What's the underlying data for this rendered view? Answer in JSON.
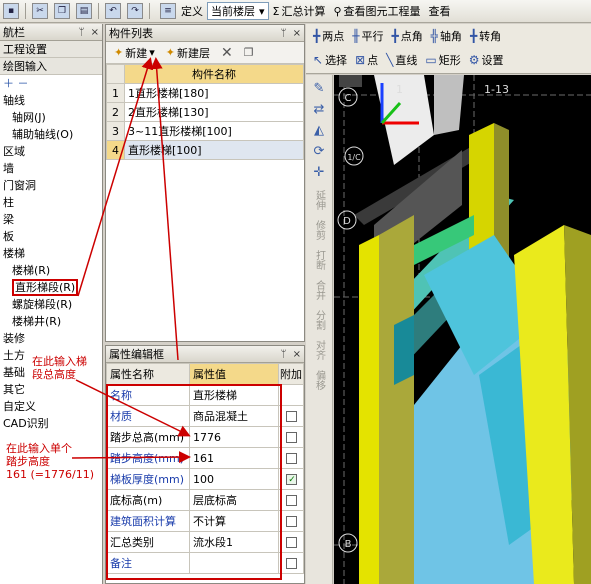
{
  "toolbar": {
    "define": "定义",
    "floor_select": "当前楼层",
    "sum_calc": "汇总计算",
    "view_quantity": "查看图元工程量",
    "view_more": "查看"
  },
  "nav": {
    "title": "航栏",
    "section_project": "工程设置",
    "section_draw": "绘图输入",
    "items": [
      "轴线",
      "轴网(J)",
      "辅助轴线(O)",
      "区域",
      "墙",
      "门窗洞",
      "柱",
      "梁",
      "板",
      "楼梯",
      "楼梯(R)",
      "直形梯段(R)",
      "螺旋梯段(R)",
      "楼梯井(R)",
      "装修",
      "土方",
      "基础",
      "其它",
      "自定义",
      "CAD识别"
    ]
  },
  "component_list": {
    "title": "构件列表",
    "new_button": "新建",
    "new_layer_button": "新建层",
    "column_header": "构件名称",
    "rows": [
      {
        "num": "1",
        "name": "1直形楼梯[180]"
      },
      {
        "num": "2",
        "name": "2直形楼梯[130]"
      },
      {
        "num": "3",
        "name": "3~11直形楼梯[100]"
      },
      {
        "num": "4",
        "name": "直形楼梯[100]"
      }
    ]
  },
  "property_editor": {
    "title": "属性编辑框",
    "header_name": "属性名称",
    "header_value": "属性值",
    "header_add": "附加",
    "rows": [
      {
        "name": "名称",
        "value": "直形楼梯",
        "checkbox": "none",
        "blue": true
      },
      {
        "name": "材质",
        "value": "商品混凝土",
        "checkbox": "off",
        "blue": true
      },
      {
        "name": "踏步总高(mm)",
        "value": "1776",
        "checkbox": "off",
        "blue": false
      },
      {
        "name": "踏步高度(mm)",
        "value": "161",
        "checkbox": "off",
        "blue": true
      },
      {
        "name": "梯板厚度(mm)",
        "value": "100",
        "checkbox": "on",
        "blue": true
      },
      {
        "name": "底标高(m)",
        "value": "层底标高",
        "checkbox": "off",
        "blue": false
      },
      {
        "name": "建筑面积计算",
        "value": "不计算",
        "checkbox": "off",
        "blue": true
      },
      {
        "name": "汇总类别",
        "value": "流水段1",
        "checkbox": "off",
        "blue": false
      },
      {
        "name": "备注",
        "value": "",
        "checkbox": "off",
        "blue": true
      }
    ]
  },
  "annotations": {
    "total_height_1": "在此输入梯",
    "total_height_2": "段总高度",
    "step_height_1": "在此输入单个",
    "step_height_2": "踏步高度",
    "step_height_3": "161 (=1776/11)"
  },
  "view_toolbar": {
    "row1": [
      "两点",
      "平行",
      "点角",
      "轴角",
      "转角"
    ],
    "row2": [
      "选择",
      "点",
      "直线",
      "矩形",
      "设置"
    ]
  },
  "side_tools": [
    "延伸",
    "修剪",
    "打断",
    "合并",
    "分割",
    "对齐",
    "偏移"
  ],
  "axis_labels": {
    "c": "C",
    "c1": "1/C",
    "d": "D",
    "b": "B",
    "grid_right": "1-13",
    "grid_left": "1"
  },
  "colors": {
    "red_annotation": "#cc0000",
    "selection_yellow": "#f4d98a"
  }
}
